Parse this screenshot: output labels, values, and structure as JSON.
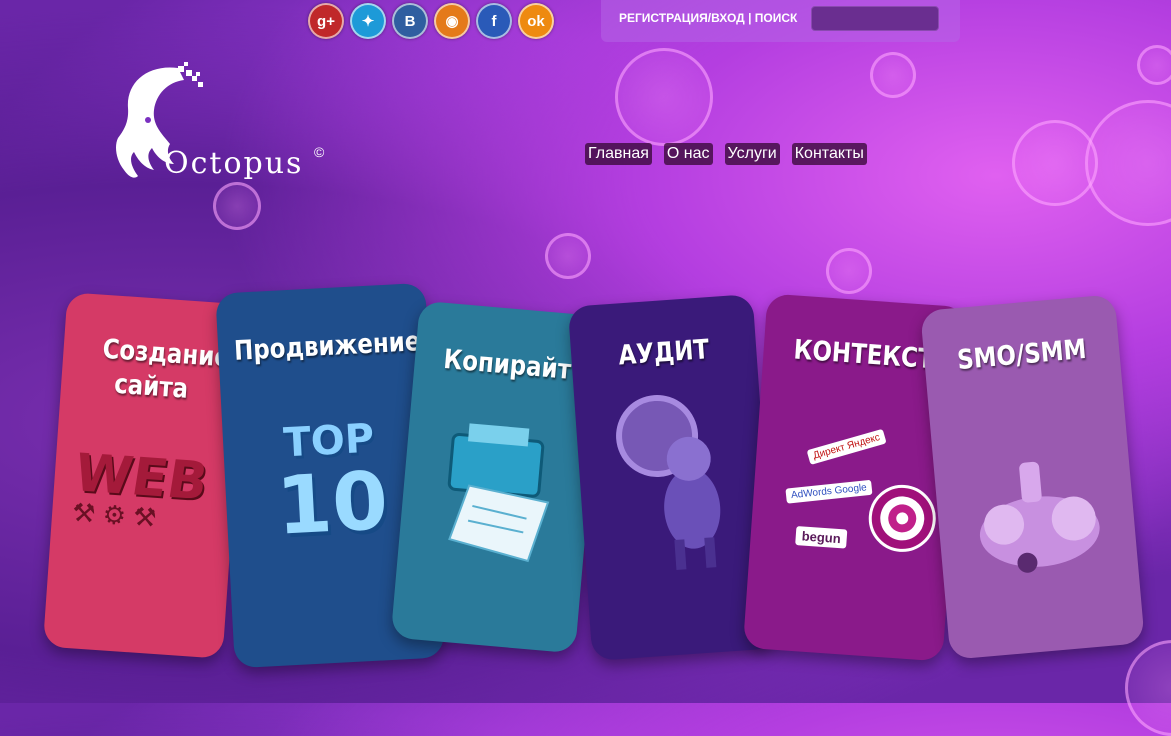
{
  "social": [
    {
      "name": "google-plus-icon",
      "glyph": "g+",
      "color": "#c0282a"
    },
    {
      "name": "twitter-icon",
      "glyph": "✦",
      "color": "#1d9ad8"
    },
    {
      "name": "vkontakte-icon",
      "glyph": "B",
      "color": "#2f5ea0"
    },
    {
      "name": "rss-icon",
      "glyph": "◉",
      "color": "#e47a1a"
    },
    {
      "name": "facebook-icon",
      "glyph": "f",
      "color": "#2a5ab8"
    },
    {
      "name": "odnoklassniki-icon",
      "glyph": "ok",
      "color": "#ee8a10"
    }
  ],
  "topbar": {
    "register_login": "РЕГИСТРАЦИЯ/ВХОД",
    "separator": " | ",
    "search": "ПОИСК",
    "search_value": ""
  },
  "logo": {
    "text": "Octopus",
    "copyright": "©"
  },
  "nav": [
    "Главная",
    "О нас",
    "Услуги",
    "Контакты"
  ],
  "cards": {
    "web": {
      "title": "Создание сайта",
      "color": "#d53a66"
    },
    "seo": {
      "title": "Продвижение",
      "color": "#1f4e8c"
    },
    "copy": {
      "title": "Копирайт",
      "color": "#2a7a9a"
    },
    "audit": {
      "title": "АУДИТ",
      "color": "#3a1a7a"
    },
    "context": {
      "title": "КОНТЕКСТ",
      "color": "#8a1a8a"
    },
    "smm": {
      "title": "SMO/SMM",
      "color": "#9a5ab0"
    }
  },
  "art": {
    "web_text": "WEB",
    "top_text": "TOP",
    "ten_text": "10",
    "direct_text": "Директ Яндекс",
    "adwords_text": "AdWords Google",
    "begun_text": "begun"
  }
}
